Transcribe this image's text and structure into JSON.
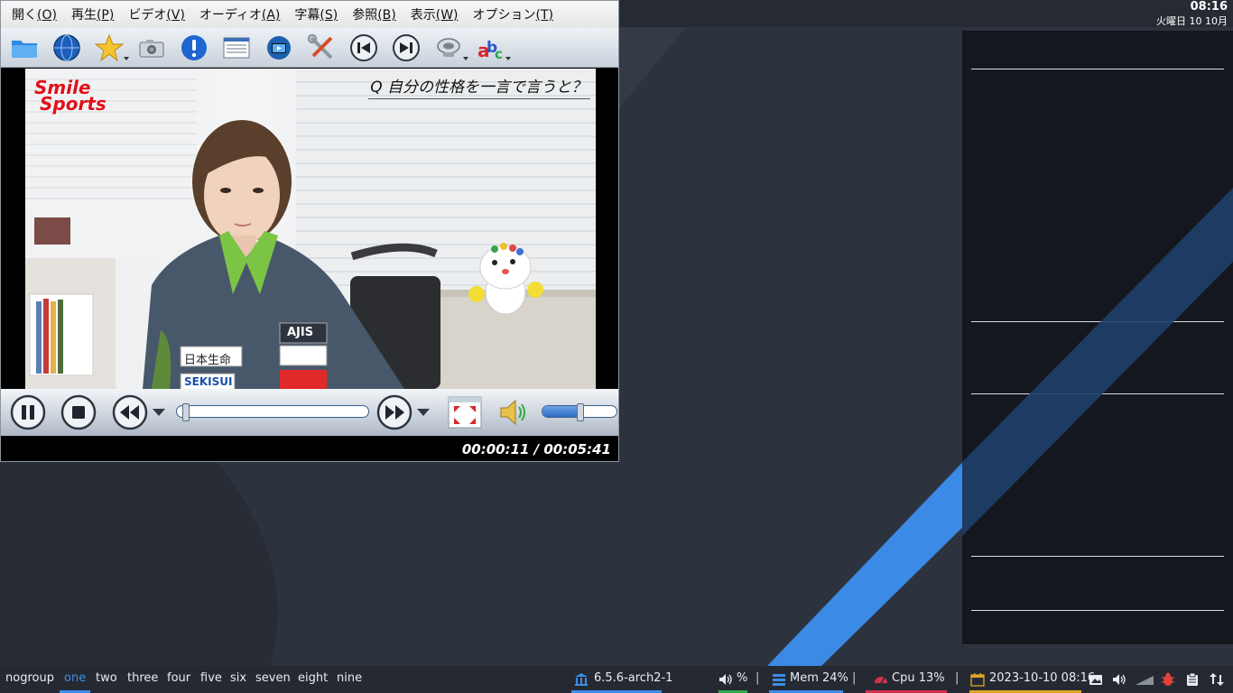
{
  "topbar": {
    "time": "08:16",
    "date": "火曜日 10 10月"
  },
  "player": {
    "menu": [
      {
        "label": "開く",
        "key": "(O)"
      },
      {
        "label": "再生",
        "key": "(P)"
      },
      {
        "label": "ビデオ",
        "key": "(V)"
      },
      {
        "label": "オーディオ",
        "key": "(A)"
      },
      {
        "label": "字幕",
        "key": "(S)"
      },
      {
        "label": "参照",
        "key": "(B)"
      },
      {
        "label": "表示",
        "key": "(W)"
      },
      {
        "label": "オプション",
        "key": "(T)"
      }
    ],
    "toolbar_icons": [
      "folder-icon",
      "globe-icon",
      "star-icon",
      "camera-icon",
      "info-icon",
      "playlist-icon",
      "video-settings-icon",
      "tools-icon",
      "previous-icon",
      "next-icon",
      "audio-track-icon",
      "subtitles-icon"
    ],
    "video": {
      "caption": "Q 自分の性格を一言で言うと？",
      "logo_line1": "Smile",
      "logo_line2": "Sports",
      "jacket_badge1": "日本生命",
      "jacket_badge2": "AJIS",
      "jacket_badge3": "SEKISUI"
    },
    "controls": {
      "seek_position": 0.02,
      "volume": 0.5
    },
    "status": {
      "timecode": "00:00:11 / 00:05:41"
    }
  },
  "taskbar": {
    "workspaces": [
      "nogroup",
      "one",
      "two",
      "three",
      "four",
      "five",
      "six",
      "seven",
      "eight",
      "nine"
    ],
    "active_workspace": "one",
    "kernel": "6.5.6-arch2-1",
    "volume": "%",
    "mem": "Mem 24%",
    "cpu": "Cpu  13%",
    "datetime": "2023-10-10 08:16",
    "colors": {
      "accent": "#3b8eea",
      "volume": "#2fa84f",
      "mem": "#3b8eea",
      "cpu": "#d3324a",
      "date": "#e0a526"
    }
  }
}
